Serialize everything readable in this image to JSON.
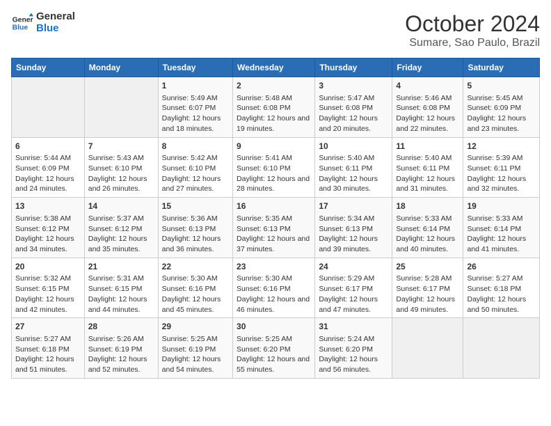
{
  "logo": {
    "line1": "General",
    "line2": "Blue"
  },
  "title": "October 2024",
  "subtitle": "Sumare, Sao Paulo, Brazil",
  "weekdays": [
    "Sunday",
    "Monday",
    "Tuesday",
    "Wednesday",
    "Thursday",
    "Friday",
    "Saturday"
  ],
  "weeks": [
    [
      {
        "day": "",
        "sunrise": "",
        "sunset": "",
        "daylight": ""
      },
      {
        "day": "",
        "sunrise": "",
        "sunset": "",
        "daylight": ""
      },
      {
        "day": "1",
        "sunrise": "Sunrise: 5:49 AM",
        "sunset": "Sunset: 6:07 PM",
        "daylight": "Daylight: 12 hours and 18 minutes."
      },
      {
        "day": "2",
        "sunrise": "Sunrise: 5:48 AM",
        "sunset": "Sunset: 6:08 PM",
        "daylight": "Daylight: 12 hours and 19 minutes."
      },
      {
        "day": "3",
        "sunrise": "Sunrise: 5:47 AM",
        "sunset": "Sunset: 6:08 PM",
        "daylight": "Daylight: 12 hours and 20 minutes."
      },
      {
        "day": "4",
        "sunrise": "Sunrise: 5:46 AM",
        "sunset": "Sunset: 6:08 PM",
        "daylight": "Daylight: 12 hours and 22 minutes."
      },
      {
        "day": "5",
        "sunrise": "Sunrise: 5:45 AM",
        "sunset": "Sunset: 6:09 PM",
        "daylight": "Daylight: 12 hours and 23 minutes."
      }
    ],
    [
      {
        "day": "6",
        "sunrise": "Sunrise: 5:44 AM",
        "sunset": "Sunset: 6:09 PM",
        "daylight": "Daylight: 12 hours and 24 minutes."
      },
      {
        "day": "7",
        "sunrise": "Sunrise: 5:43 AM",
        "sunset": "Sunset: 6:10 PM",
        "daylight": "Daylight: 12 hours and 26 minutes."
      },
      {
        "day": "8",
        "sunrise": "Sunrise: 5:42 AM",
        "sunset": "Sunset: 6:10 PM",
        "daylight": "Daylight: 12 hours and 27 minutes."
      },
      {
        "day": "9",
        "sunrise": "Sunrise: 5:41 AM",
        "sunset": "Sunset: 6:10 PM",
        "daylight": "Daylight: 12 hours and 28 minutes."
      },
      {
        "day": "10",
        "sunrise": "Sunrise: 5:40 AM",
        "sunset": "Sunset: 6:11 PM",
        "daylight": "Daylight: 12 hours and 30 minutes."
      },
      {
        "day": "11",
        "sunrise": "Sunrise: 5:40 AM",
        "sunset": "Sunset: 6:11 PM",
        "daylight": "Daylight: 12 hours and 31 minutes."
      },
      {
        "day": "12",
        "sunrise": "Sunrise: 5:39 AM",
        "sunset": "Sunset: 6:11 PM",
        "daylight": "Daylight: 12 hours and 32 minutes."
      }
    ],
    [
      {
        "day": "13",
        "sunrise": "Sunrise: 5:38 AM",
        "sunset": "Sunset: 6:12 PM",
        "daylight": "Daylight: 12 hours and 34 minutes."
      },
      {
        "day": "14",
        "sunrise": "Sunrise: 5:37 AM",
        "sunset": "Sunset: 6:12 PM",
        "daylight": "Daylight: 12 hours and 35 minutes."
      },
      {
        "day": "15",
        "sunrise": "Sunrise: 5:36 AM",
        "sunset": "Sunset: 6:13 PM",
        "daylight": "Daylight: 12 hours and 36 minutes."
      },
      {
        "day": "16",
        "sunrise": "Sunrise: 5:35 AM",
        "sunset": "Sunset: 6:13 PM",
        "daylight": "Daylight: 12 hours and 37 minutes."
      },
      {
        "day": "17",
        "sunrise": "Sunrise: 5:34 AM",
        "sunset": "Sunset: 6:13 PM",
        "daylight": "Daylight: 12 hours and 39 minutes."
      },
      {
        "day": "18",
        "sunrise": "Sunrise: 5:33 AM",
        "sunset": "Sunset: 6:14 PM",
        "daylight": "Daylight: 12 hours and 40 minutes."
      },
      {
        "day": "19",
        "sunrise": "Sunrise: 5:33 AM",
        "sunset": "Sunset: 6:14 PM",
        "daylight": "Daylight: 12 hours and 41 minutes."
      }
    ],
    [
      {
        "day": "20",
        "sunrise": "Sunrise: 5:32 AM",
        "sunset": "Sunset: 6:15 PM",
        "daylight": "Daylight: 12 hours and 42 minutes."
      },
      {
        "day": "21",
        "sunrise": "Sunrise: 5:31 AM",
        "sunset": "Sunset: 6:15 PM",
        "daylight": "Daylight: 12 hours and 44 minutes."
      },
      {
        "day": "22",
        "sunrise": "Sunrise: 5:30 AM",
        "sunset": "Sunset: 6:16 PM",
        "daylight": "Daylight: 12 hours and 45 minutes."
      },
      {
        "day": "23",
        "sunrise": "Sunrise: 5:30 AM",
        "sunset": "Sunset: 6:16 PM",
        "daylight": "Daylight: 12 hours and 46 minutes."
      },
      {
        "day": "24",
        "sunrise": "Sunrise: 5:29 AM",
        "sunset": "Sunset: 6:17 PM",
        "daylight": "Daylight: 12 hours and 47 minutes."
      },
      {
        "day": "25",
        "sunrise": "Sunrise: 5:28 AM",
        "sunset": "Sunset: 6:17 PM",
        "daylight": "Daylight: 12 hours and 49 minutes."
      },
      {
        "day": "26",
        "sunrise": "Sunrise: 5:27 AM",
        "sunset": "Sunset: 6:18 PM",
        "daylight": "Daylight: 12 hours and 50 minutes."
      }
    ],
    [
      {
        "day": "27",
        "sunrise": "Sunrise: 5:27 AM",
        "sunset": "Sunset: 6:18 PM",
        "daylight": "Daylight: 12 hours and 51 minutes."
      },
      {
        "day": "28",
        "sunrise": "Sunrise: 5:26 AM",
        "sunset": "Sunset: 6:19 PM",
        "daylight": "Daylight: 12 hours and 52 minutes."
      },
      {
        "day": "29",
        "sunrise": "Sunrise: 5:25 AM",
        "sunset": "Sunset: 6:19 PM",
        "daylight": "Daylight: 12 hours and 54 minutes."
      },
      {
        "day": "30",
        "sunrise": "Sunrise: 5:25 AM",
        "sunset": "Sunset: 6:20 PM",
        "daylight": "Daylight: 12 hours and 55 minutes."
      },
      {
        "day": "31",
        "sunrise": "Sunrise: 5:24 AM",
        "sunset": "Sunset: 6:20 PM",
        "daylight": "Daylight: 12 hours and 56 minutes."
      },
      {
        "day": "",
        "sunrise": "",
        "sunset": "",
        "daylight": ""
      },
      {
        "day": "",
        "sunrise": "",
        "sunset": "",
        "daylight": ""
      }
    ]
  ]
}
